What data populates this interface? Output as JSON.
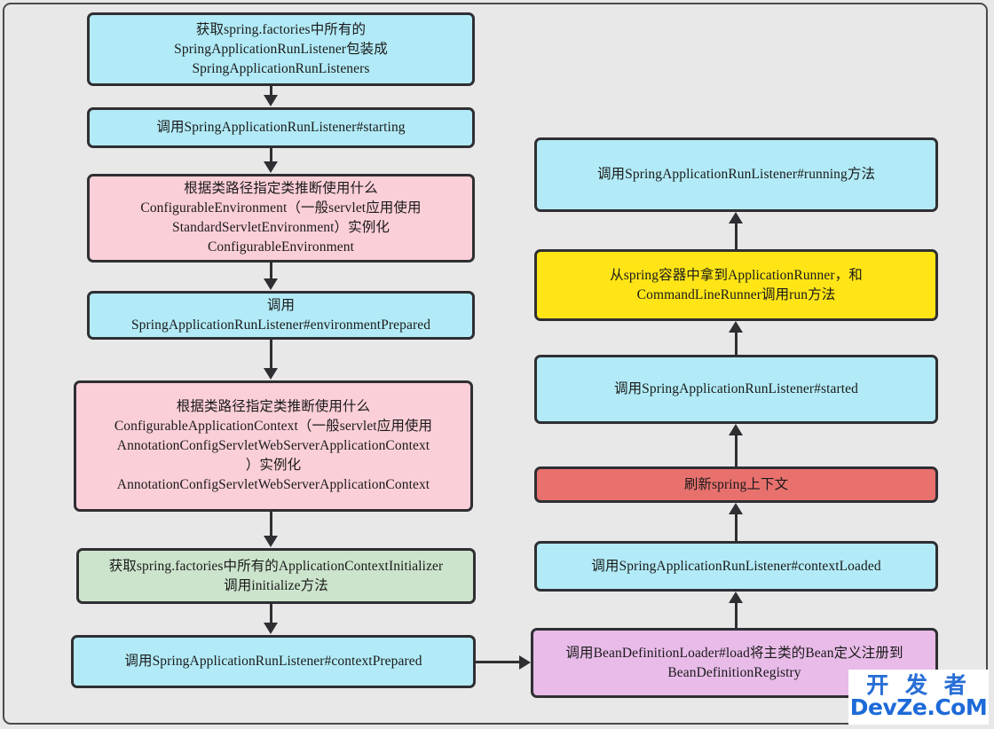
{
  "diagram": {
    "title": "SpringApplication run flow",
    "background_color": "#e8e8e8",
    "border_color": "#2f2f33",
    "palette": {
      "blue": "#b2ebf7",
      "pink": "#fbcfd8",
      "green": "#cce4cc",
      "yellow": "#ffe516",
      "red": "#e8716e",
      "purple": "#e8bbe8"
    }
  },
  "nodes": {
    "n1": "获取spring.factories中所有的\nSpringApplicationRunListener包装成\nSpringApplicationRunListeners",
    "n2": "调用SpringApplicationRunListener#starting",
    "n3": "根据类路径指定类推断使用什么\nConfigurableEnvironment（一般servlet应用使用\nStandardServletEnvironment）实例化\nConfigurableEnvironment",
    "n4": "调用\nSpringApplicationRunListener#environmentPrepared",
    "n5": "根据类路径指定类推断使用什么\nConfigurableApplicationContext（一般servlet应用使用\nAnnotationConfigServletWebServerApplicationContext\n）实例化\nAnnotationConfigServletWebServerApplicationContext",
    "n6": "获取spring.factories中所有的ApplicationContextInitializer\n调用initialize方法",
    "n7": "调用SpringApplicationRunListener#contextPrepared",
    "n8": "调用BeanDefinitionLoader#load将主类的Bean定义注册到\nBeanDefinitionRegistry",
    "n9": "调用SpringApplicationRunListener#contextLoaded",
    "n10": "刷新spring上下文",
    "n11": "调用SpringApplicationRunListener#started",
    "n12": "从spring容器中拿到ApplicationRunner，和\nCommandLineRunner调用run方法",
    "n13": "调用SpringApplicationRunListener#running方法"
  },
  "watermark": {
    "line1": "开 发 者",
    "line2": "DevZe.CoM"
  }
}
